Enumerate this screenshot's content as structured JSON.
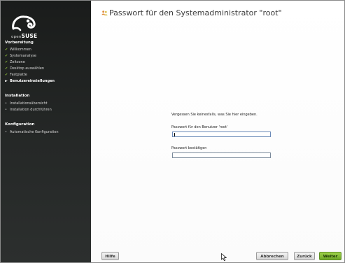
{
  "brand": {
    "name": "SUSE",
    "prefix": "open"
  },
  "colors": {
    "sidebar_bg": "#1f2120",
    "accent_green": "#7cb534",
    "check_green": "#8fbf3a"
  },
  "sidebar": {
    "sections": [
      {
        "title": "Vorbereitung",
        "items": [
          {
            "label": "Willkommen",
            "state": "done"
          },
          {
            "label": "Systemanalyse",
            "state": "done"
          },
          {
            "label": "Zeitzone",
            "state": "done"
          },
          {
            "label": "Desktop auswählen",
            "state": "done"
          },
          {
            "label": "Festplatte",
            "state": "done"
          },
          {
            "label": "Benutzereinstellungen",
            "state": "current"
          }
        ]
      },
      {
        "title": "Installation",
        "items": [
          {
            "label": "Installationsübersicht",
            "state": "pending"
          },
          {
            "label": "Installation durchführen",
            "state": "pending"
          }
        ]
      },
      {
        "title": "Konfiguration",
        "items": [
          {
            "label": "Automatische Konfiguration",
            "state": "pending"
          }
        ]
      }
    ]
  },
  "main": {
    "title": "Passwort für den Systemadministrator \"root\"",
    "title_icon": "users-icon",
    "hint": "Vergessen Sie keinesfalls, was Sie hier eingeben.",
    "password_label": "Passwort für den Benutzer 'root'",
    "password_value": "",
    "confirm_label": "Passwort bestätigen",
    "confirm_value": ""
  },
  "buttons": {
    "help": "Hilfe",
    "cancel": "Abbrechen",
    "back": "Zurück",
    "next": "Weiter"
  }
}
